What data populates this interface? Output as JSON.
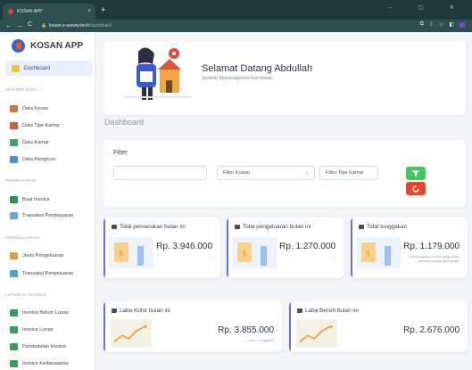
{
  "browser": {
    "tab_title": "KOSAN APP",
    "tab_close": "×",
    "new_tab": "+",
    "window_controls": "– ▢ ✕",
    "url_host": "kosan.e-survey.tech",
    "url_path": "/dashboard",
    "nav_back": "←",
    "nav_forward": "→",
    "nav_reload": "C",
    "addr_icons": [
      "⧉",
      "⇪",
      "☆",
      "◧"
    ]
  },
  "sidebar": {
    "app_name": "KOSAN APP",
    "active": "Dashboard",
    "sections": [
      {
        "label": "MASTER DATA",
        "items": [
          "Data Kosan",
          "Data Tipe Kamar",
          "Data Kamar",
          "Data Penghuni"
        ]
      },
      {
        "label": "PEMBAYARAN",
        "items": [
          "Buat Invoice",
          "Transaksi Pembayaran"
        ]
      },
      {
        "label": "PENGELUARAN",
        "items": [
          "Jenis Pengeluaran",
          "Transaksi Pengeluaran"
        ]
      },
      {
        "label": "LAPORAN INVOICE",
        "items": [
          "Invoice Belum Lunas",
          "Invoice Lunas",
          "Pembatalan Invoice",
          "Invoice Kedaluwarsa"
        ]
      }
    ]
  },
  "welcome": {
    "title": "Selamat Datang Abdullah",
    "subtitle": "System Manenejemen kos-kosan"
  },
  "dashboard_title": "Dashboard",
  "filter": {
    "title": "Filter",
    "input_value": "",
    "kosan_select": "Filter Kosan",
    "tipe_select": "Filter Tipe Kamar",
    "filter_icon": "filter-icon",
    "reset_icon": "reset-icon",
    "filter_color": "#3ec95a",
    "reset_color": "#e8452d"
  },
  "cards": {
    "pemasukan": {
      "title": "Total pemasukan bulan ini",
      "value": "Rp. 3.946.000",
      "note": "—"
    },
    "pengeluaran": {
      "title": "Total pengeluaran bulan ini",
      "value": "Rp. 1.270.000",
      "note": "—"
    },
    "tunggakan": {
      "title": "Total tunggakan",
      "value": "Rp. 1.179.000",
      "note": "Total tunggakan invoice yang sudah melewati tanggal jatuh tempo"
    },
    "laba_kotor": {
      "title": "Laba Kotor bulan ini",
      "value": "Rp. 3.855.000",
      "note": "— Laba • Tunggakan"
    },
    "laba_bersih": {
      "title": "Laba Bersih bulan ini",
      "value": "Rp. 2.676.000",
      "note": ""
    }
  },
  "colors": {
    "accent": "#3a4ad8",
    "card_accent": "#6b6fe0",
    "chrome": "#1f3a3a"
  }
}
